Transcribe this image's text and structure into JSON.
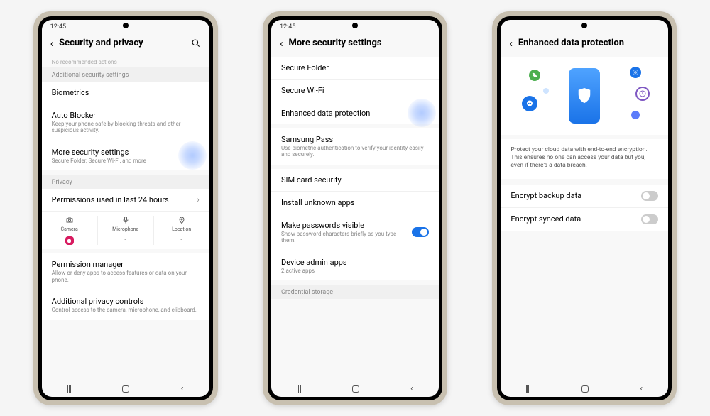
{
  "status_time": "12:45",
  "phone1": {
    "title": "Security and privacy",
    "no_rec": "No recommended actions",
    "sec_additional": "Additional security settings",
    "biometrics": "Biometrics",
    "auto_blocker": {
      "title": "Auto Blocker",
      "sub": "Keep your phone safe by blocking threats and other suspicious activity."
    },
    "more_sec": {
      "title": "More security settings",
      "sub": "Secure Folder, Secure Wi-Fi, and more"
    },
    "sec_privacy": "Privacy",
    "perms_24h": "Permissions used in last 24 hours",
    "perm_camera": "Camera",
    "perm_microphone": "Microphone",
    "perm_location": "Location",
    "perm_manager": {
      "title": "Permission manager",
      "sub": "Allow or deny apps to access features or data on your phone."
    },
    "addl_privacy": {
      "title": "Additional privacy controls",
      "sub": "Control access to the camera, microphone, and clipboard."
    }
  },
  "phone2": {
    "title": "More security settings",
    "secure_folder": "Secure Folder",
    "secure_wifi": "Secure Wi-Fi",
    "enhanced": "Enhanced data protection",
    "samsung_pass": {
      "title": "Samsung Pass",
      "sub": "Use biometric authentication to verify your identity easily and securely."
    },
    "sim_security": "SIM card security",
    "install_unknown": "Install unknown apps",
    "passwords_visible": {
      "title": "Make passwords visible",
      "sub": "Show password characters briefly as you type them."
    },
    "device_admin": {
      "title": "Device admin apps",
      "sub": "2 active apps"
    },
    "credential_storage": "Credential storage"
  },
  "phone3": {
    "title": "Enhanced data protection",
    "desc": "Protect your cloud data with end-to-end encryption. This ensures no one can access your data but you, even if there's a data breach.",
    "encrypt_backup": "Encrypt backup data",
    "encrypt_synced": "Encrypt synced data"
  }
}
